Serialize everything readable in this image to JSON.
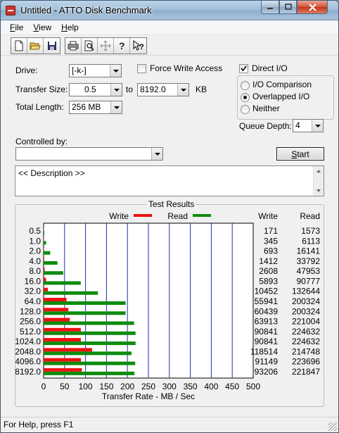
{
  "window": {
    "title": "Untitled - ATTO Disk Benchmark"
  },
  "menu": [
    "File",
    "View",
    "Help"
  ],
  "toolbar": {
    "icons": [
      "new-icon",
      "open-icon",
      "save-icon",
      "print-icon",
      "print-preview-icon",
      "move-icon",
      "help-icon",
      "context-help-icon"
    ]
  },
  "form": {
    "drive_label": "Drive:",
    "drive_value": "[-k-]",
    "force_write_label": "Force Write Access",
    "force_write_checked": false,
    "direct_io_label": "Direct I/O",
    "direct_io_checked": true,
    "transfer_size_label": "Transfer Size:",
    "transfer_from": "0.5",
    "transfer_to_label": "to",
    "transfer_to": "8192.0",
    "transfer_unit": "KB",
    "total_length_label": "Total Length:",
    "total_length_value": "256 MB",
    "io_options": [
      {
        "label": "I/O Comparison",
        "selected": false
      },
      {
        "label": "Overlapped I/O",
        "selected": true
      },
      {
        "label": "Neither",
        "selected": false
      }
    ],
    "queue_depth_label": "Queue Depth:",
    "queue_depth_value": "4",
    "controlled_by_label": "Controlled by:",
    "controlled_by_value": "",
    "start_label": "Start",
    "description": "<< Description >>"
  },
  "results": {
    "title": "Test Results",
    "legend_write": "Write",
    "legend_read": "Read",
    "col_write": "Write",
    "col_read": "Read"
  },
  "chart_data": {
    "type": "bar",
    "orientation": "horizontal",
    "xlabel": "Transfer Rate - MB / Sec",
    "xlim": [
      0,
      500
    ],
    "xticks": [
      0,
      50,
      100,
      150,
      200,
      250,
      300,
      350,
      400,
      450,
      500
    ],
    "grid": true,
    "legend_position": "top",
    "categories": [
      "0.5",
      "1.0",
      "2.0",
      "4.0",
      "8.0",
      "16.0",
      "32.0",
      "64.0",
      "128.0",
      "256.0",
      "512.0",
      "1024.0",
      "2048.0",
      "4096.0",
      "8192.0"
    ],
    "series": [
      {
        "name": "Write",
        "color": "#ee1111",
        "values": [
          171,
          345,
          693,
          1412,
          2608,
          5893,
          10452,
          55941,
          60439,
          63913,
          90841,
          90841,
          118514,
          91149,
          93206
        ]
      },
      {
        "name": "Read",
        "color": "#0e8c0e",
        "values": [
          1573,
          6113,
          16141,
          33792,
          47953,
          90777,
          132644,
          200324,
          200324,
          221004,
          224632,
          224632,
          214748,
          223696,
          221847
        ]
      }
    ],
    "value_unit_note": "table values in KB/s"
  },
  "status": {
    "text": "For Help, press F1"
  }
}
